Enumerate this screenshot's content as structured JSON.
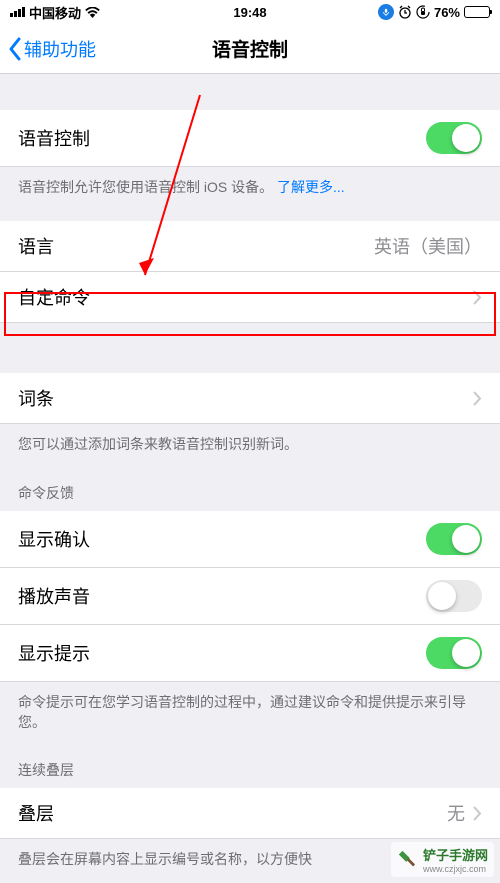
{
  "status": {
    "carrier": "中国移动",
    "time": "19:48",
    "battery_pct": "76%",
    "battery_fill_width": "76%"
  },
  "nav": {
    "back_label": "辅助功能",
    "title": "语音控制"
  },
  "rows": {
    "voice_control_label": "语音控制",
    "voice_control_on": true,
    "voice_control_note": "语音控制允许您使用语音控制 iOS 设备。",
    "learn_more": "了解更多...",
    "language_label": "语言",
    "language_value": "英语（美国）",
    "custom_cmd_label": "自定命令",
    "vocab_label": "词条",
    "vocab_note": "您可以通过添加词条来教语音控制识别新词。",
    "feedback_header": "命令反馈",
    "show_confirm_label": "显示确认",
    "show_confirm_on": true,
    "play_sound_label": "播放声音",
    "play_sound_on": false,
    "show_hints_label": "显示提示",
    "show_hints_on": true,
    "hints_note": "命令提示可在您学习语音控制的过程中，通过建议命令和提供提示来引导您。",
    "overlay_header": "连续叠层",
    "overlay_label": "叠层",
    "overlay_value": "无",
    "overlay_note": "叠层会在屏幕内容上显示编号或名称，以方便快"
  },
  "watermark": {
    "brand": "铲子手游网",
    "url": "www.czjxjc.com"
  }
}
